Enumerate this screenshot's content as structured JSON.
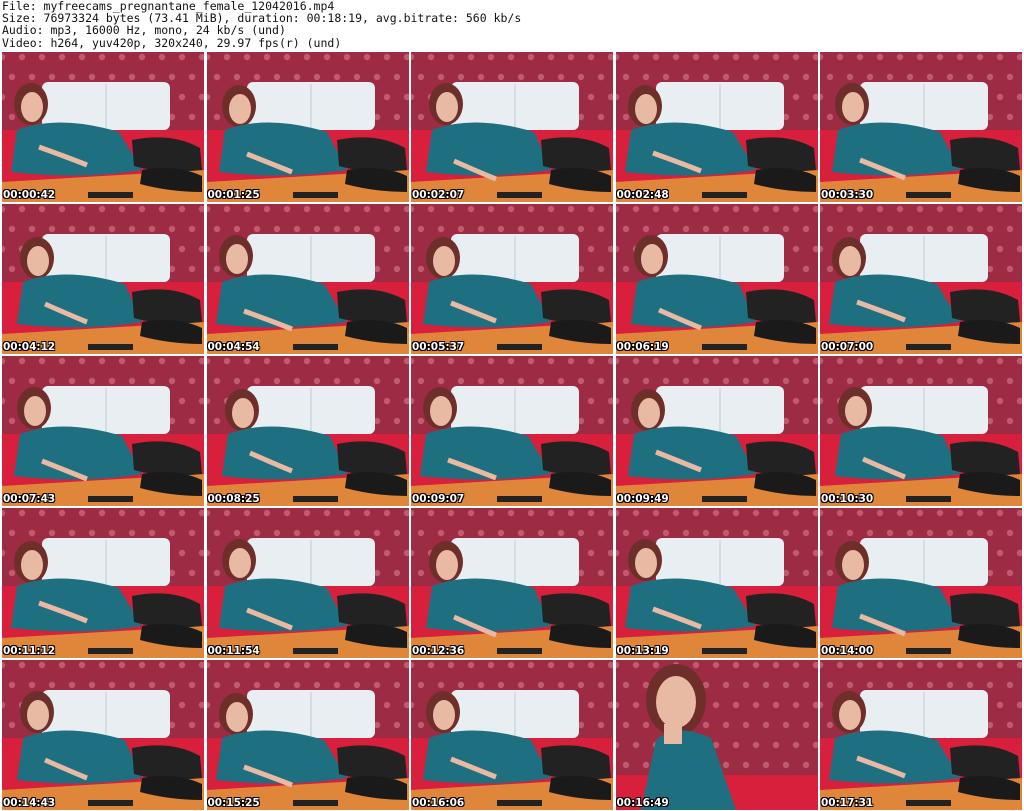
{
  "header": {
    "file_line": "File: myfreecams_pregnantane_female_12042016.mp4",
    "size_line": "Size: 76973324 bytes (73.41 MiB), duration: 00:18:19, avg.bitrate: 560 kb/s",
    "audio_line": "Audio: mp3, 16000 Hz, mono, 24 kb/s (und)",
    "video_line": "Video: h264, yuv420p, 320x240, 29.97 fps(r) (und)"
  },
  "colors": {
    "wallpaper": "#9e2b44",
    "headboard": "#e9eef3",
    "dress": "#1e6f80",
    "bed_orange": "#e0863a",
    "pillow_red": "#d8203c"
  },
  "frames": [
    {
      "time": "00:00:42"
    },
    {
      "time": "00:01:25"
    },
    {
      "time": "00:02:07"
    },
    {
      "time": "00:02:48"
    },
    {
      "time": "00:03:30"
    },
    {
      "time": "00:04:12"
    },
    {
      "time": "00:04:54"
    },
    {
      "time": "00:05:37"
    },
    {
      "time": "00:06:19"
    },
    {
      "time": "00:07:00"
    },
    {
      "time": "00:07:43"
    },
    {
      "time": "00:08:25"
    },
    {
      "time": "00:09:07"
    },
    {
      "time": "00:09:49"
    },
    {
      "time": "00:10:30"
    },
    {
      "time": "00:11:12"
    },
    {
      "time": "00:11:54"
    },
    {
      "time": "00:12:36"
    },
    {
      "time": "00:13:19"
    },
    {
      "time": "00:14:00"
    },
    {
      "time": "00:14:43"
    },
    {
      "time": "00:15:25"
    },
    {
      "time": "00:16:06"
    },
    {
      "time": "00:16:49",
      "closeup": true
    },
    {
      "time": "00:17:31"
    }
  ]
}
